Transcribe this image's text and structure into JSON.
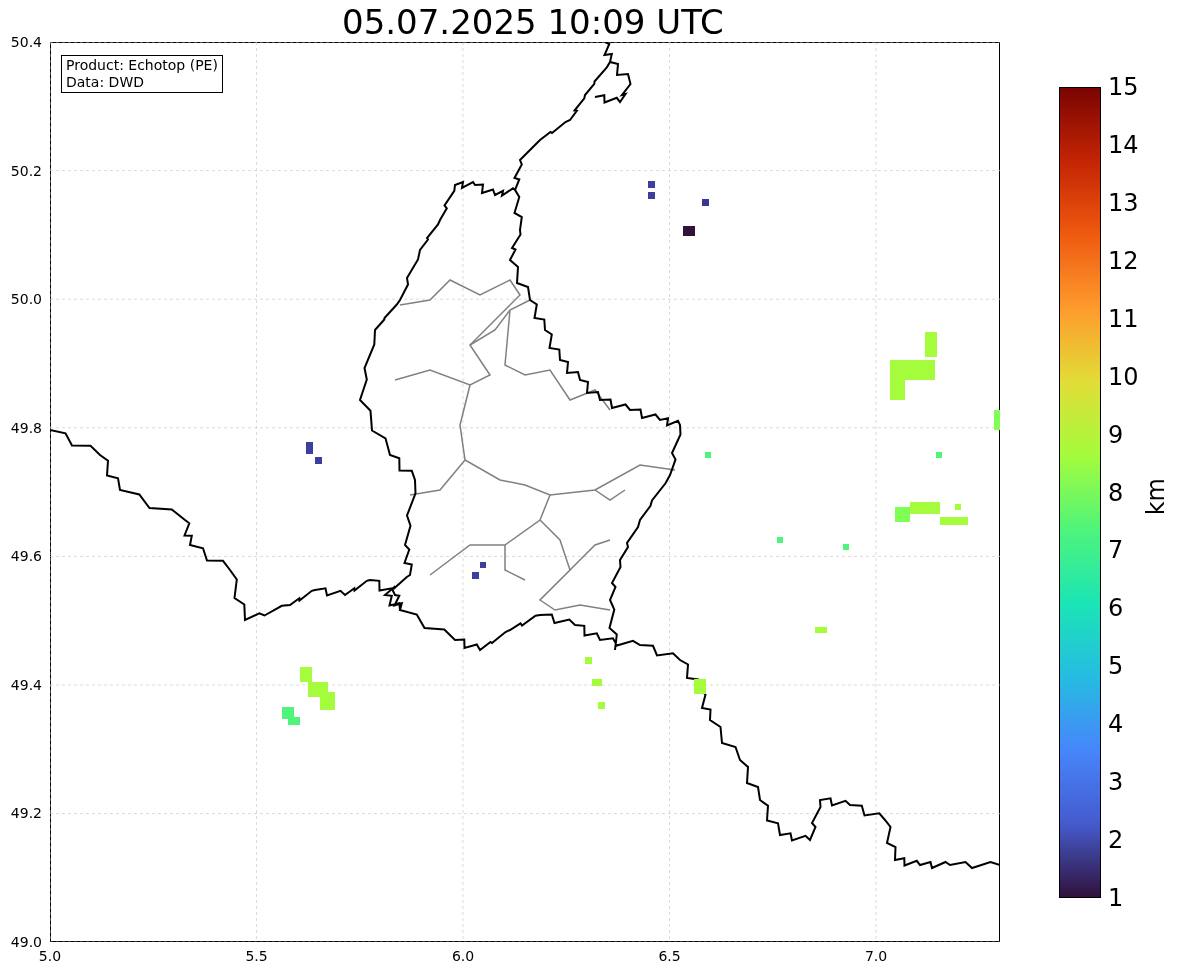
{
  "title": "05.07.2025 10:09 UTC",
  "info_box": [
    "Product: Echotop (PE)",
    "Data: DWD"
  ],
  "x_axis": {
    "ticks": [
      "5.0",
      "5.5",
      "6.0",
      "6.5",
      "7.0"
    ]
  },
  "y_axis": {
    "ticks": [
      "50.4",
      "50.2",
      "50.0",
      "49.8",
      "49.6",
      "49.4",
      "49.2",
      "49.0"
    ]
  },
  "colorbar": {
    "label": "km",
    "ticks": [
      "15",
      "14",
      "13",
      "12",
      "11",
      "10",
      "9",
      "8",
      "7",
      "6",
      "5",
      "4",
      "3",
      "2",
      "1"
    ]
  }
}
